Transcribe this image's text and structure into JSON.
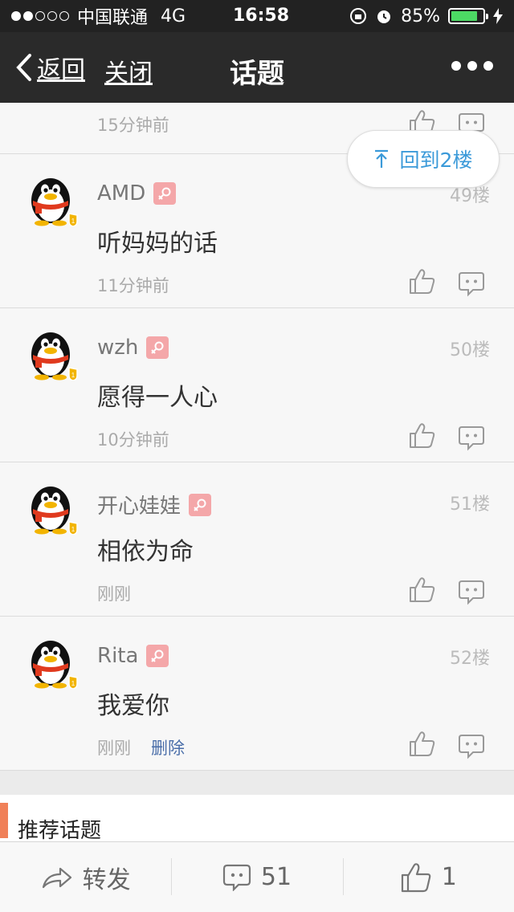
{
  "status_bar": {
    "carrier": "中国联通",
    "network": "4G",
    "time": "16:58",
    "battery": "85%",
    "battery_level": 0.85
  },
  "nav": {
    "back_label": "返回",
    "close_label": "关闭",
    "title": "话题"
  },
  "back_to_floor": {
    "label": "回到2楼",
    "arrow": "↑"
  },
  "partial_item": {
    "time": "15分钟前"
  },
  "comments": [
    {
      "name": "AMD",
      "floor": "49楼",
      "content": "听妈妈的话",
      "time": "11分钟前"
    },
    {
      "name": "wzh",
      "floor": "50楼",
      "content": "愿得一人心",
      "time": "10分钟前"
    },
    {
      "name": "开心娃娃",
      "floor": "51楼",
      "content": "相依为命",
      "time": "刚刚"
    },
    {
      "name": "Rita",
      "floor": "52楼",
      "content": "我爱你",
      "time": "刚刚",
      "delete": "删除"
    }
  ],
  "recommend": {
    "title": "推荐话题"
  },
  "toolbar": {
    "forward_label": "转发",
    "comment_count": "51",
    "like_count": "1"
  },
  "colors": {
    "accent_blue": "#3b9ad9",
    "recommend_bar": "#f08058",
    "gender_badge": "#f4a7a9",
    "delete_link": "#4a6ea9"
  },
  "icons": {
    "avatar": "qq-penguin-avatar",
    "gender": "female-gender-icon",
    "like": "thumbs-up-icon",
    "comment": "comment-bubble-icon",
    "forward": "share-arrow-icon"
  }
}
